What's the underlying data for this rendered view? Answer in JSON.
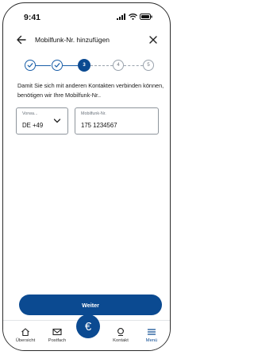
{
  "status": {
    "time": "9:41"
  },
  "header": {
    "title": "Mobilfunk-Nr. hinzufügen"
  },
  "stepper": {
    "steps": [
      {
        "label": "",
        "state": "done"
      },
      {
        "label": "",
        "state": "done"
      },
      {
        "label": "3",
        "state": "active"
      },
      {
        "label": "4",
        "state": "future"
      },
      {
        "label": "5",
        "state": "future"
      }
    ]
  },
  "intro_text": "Damit Sie sich mit anderen Kontakten verbinden können, benötigen wir Ihre Mobilfunk-Nr..",
  "prefix_field": {
    "label": "Vorwa...",
    "value": "DE +49"
  },
  "phone_field": {
    "label": "Mobilfunk-Nr.",
    "value": "175 1234567"
  },
  "cta_label": "Weiter",
  "nav": {
    "items": [
      {
        "label": "Übersicht",
        "icon": "home-icon"
      },
      {
        "label": "Postfach",
        "icon": "mail-icon"
      },
      {
        "label": "",
        "icon": "euro-icon"
      },
      {
        "label": "Kontakt",
        "icon": "contact-icon"
      },
      {
        "label": "Menü",
        "icon": "menu-icon"
      }
    ]
  },
  "colors": {
    "primary": "#0b4a91",
    "step_done": "#1a5fa8",
    "text": "#111111"
  }
}
